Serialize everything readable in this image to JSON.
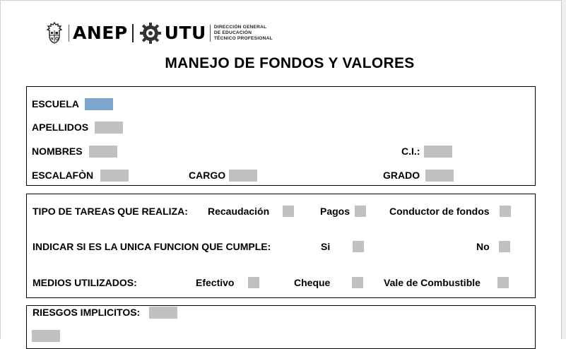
{
  "header": {
    "logo_anep": "ANEP",
    "logo_utu": "UTU",
    "institution_lines": [
      "DIRECCIÓN GENERAL",
      "DE EDUCACIÓN",
      "TÉCNICO PROFESIONAL"
    ]
  },
  "title": "MANEJO DE FONDOS Y VALORES",
  "personal": {
    "escuela_label": "ESCUELA",
    "apellidos_label": "APELLIDOS",
    "nombres_label": "NOMBRES",
    "ci_label": "C.I.:",
    "escalafon_label": "ESCALAFÒN",
    "cargo_label": "CARGO",
    "grado_label": "GRADO"
  },
  "tareas": {
    "tipo_label": "TIPO DE TAREAS QUE REALIZA:",
    "recaudacion_label": "Recaudación",
    "pagos_label": "Pagos",
    "conductor_label": "Conductor de fondos",
    "unica_label": "INDICAR SI ES LA UNICA FUNCION QUE CUMPLE:",
    "si_label": "Si",
    "no_label": "No",
    "medios_label": "MEDIOS UTILIZADOS:",
    "efectivo_label": "Efectivo",
    "cheque_label": "Cheque",
    "vale_label": "Vale de Combustible"
  },
  "riesgos": {
    "label": "RIESGOS IMPLICITOS:"
  },
  "colors": {
    "field_fill": "#c0c0c0",
    "active_field_fill": "#7ea7cf"
  }
}
